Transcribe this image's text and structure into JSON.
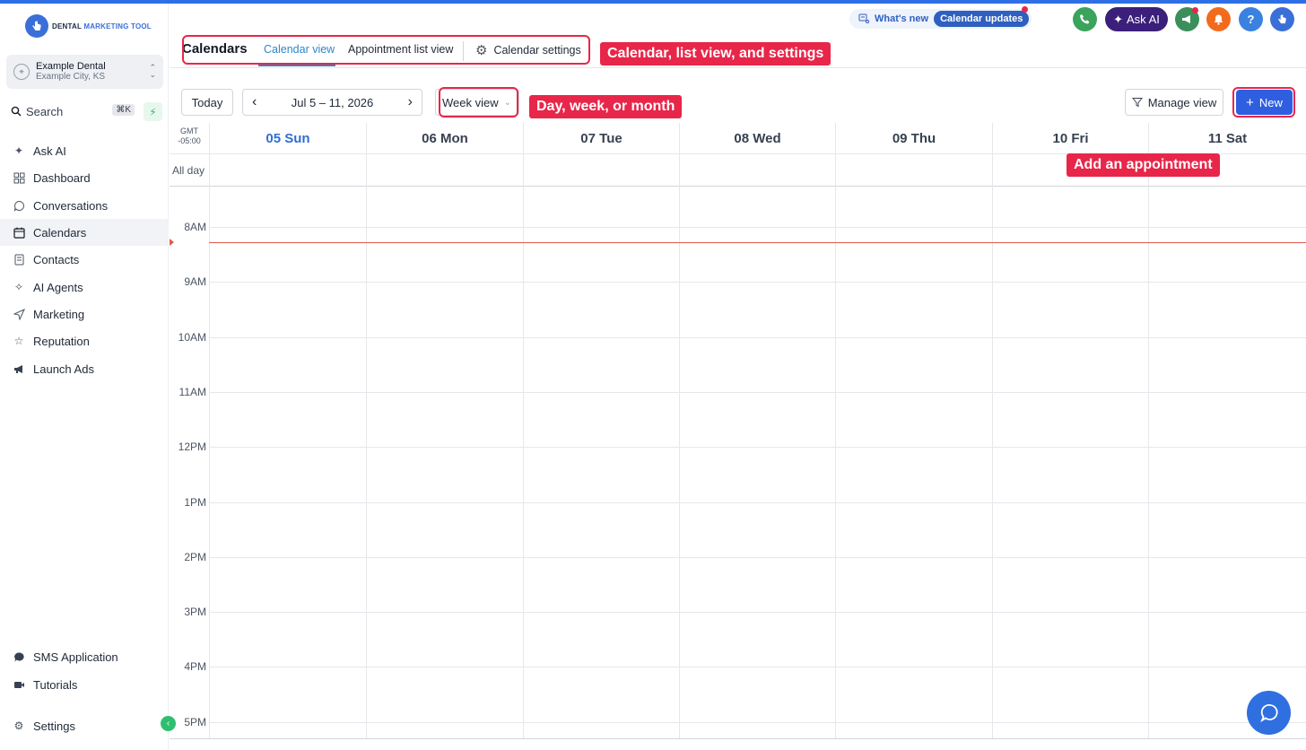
{
  "app": {
    "logo_text_1": "DENTAL",
    "logo_text_2": "MARKETING TOOL"
  },
  "account": {
    "name": "Example Dental",
    "location": "Example City, KS"
  },
  "search": {
    "placeholder": "Search",
    "shortcut": "⌘K"
  },
  "nav": {
    "items": [
      {
        "label": "Ask AI",
        "icon": "sparkle-icon"
      },
      {
        "label": "Dashboard",
        "icon": "grid-icon"
      },
      {
        "label": "Conversations",
        "icon": "chat-bubble-icon"
      },
      {
        "label": "Calendars",
        "icon": "calendar-icon"
      },
      {
        "label": "Contacts",
        "icon": "contacts-icon"
      },
      {
        "label": "AI Agents",
        "icon": "ai-agents-icon"
      },
      {
        "label": "Marketing",
        "icon": "send-icon"
      },
      {
        "label": "Reputation",
        "icon": "star-icon"
      },
      {
        "label": "Launch Ads",
        "icon": "megaphone-icon"
      }
    ],
    "bottom": [
      {
        "label": "SMS Application",
        "icon": "message-icon"
      },
      {
        "label": "Tutorials",
        "icon": "video-icon"
      },
      {
        "label": "Settings",
        "icon": "gear-icon"
      }
    ],
    "active": "Calendars"
  },
  "header": {
    "title": "Calendars",
    "tabs": [
      "Calendar view",
      "Appointment list view",
      "Calendar settings"
    ],
    "active_tab": "Calendar view",
    "whats_new": "What's new",
    "updates": "Calendar updates",
    "ask_ai": "Ask AI",
    "help": "?"
  },
  "annotations": {
    "tabs": "Calendar, list view, and settings",
    "view": "Day, week, or month",
    "new": "Add an appointment"
  },
  "toolbar": {
    "today": "Today",
    "date_range": "Jul 5 – 11, 2026",
    "prev": "‹",
    "next": "›",
    "view_select": "Week view",
    "manage_view": "Manage view",
    "new": "New"
  },
  "calendar": {
    "timezone_line1": "GMT",
    "timezone_line2": "-05:00",
    "all_day": "All day",
    "days": [
      "05 Sun",
      "06 Mon",
      "07 Tue",
      "08 Wed",
      "09 Thu",
      "10 Fri",
      "11 Sat"
    ],
    "today_index": 0,
    "hours": [
      "8AM",
      "9AM",
      "10AM",
      "11AM",
      "12PM",
      "1PM",
      "2PM",
      "3PM",
      "4PM",
      "5PM"
    ]
  },
  "colors": {
    "accent": "#2f5fe0",
    "annotation": "#e8264a",
    "now_line": "#e05a4a"
  }
}
